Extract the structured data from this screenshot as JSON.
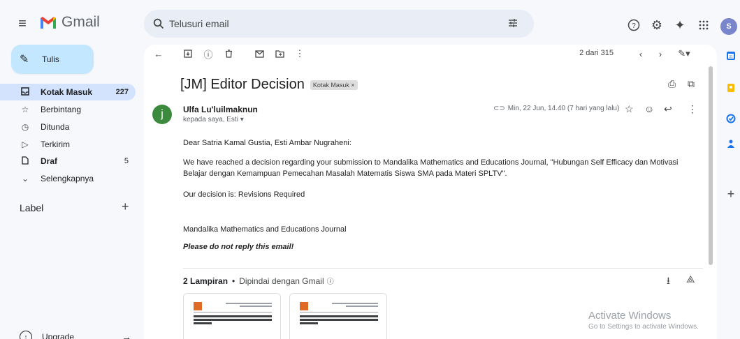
{
  "header": {
    "app_name": "Gmail",
    "search_placeholder": "Telusuri email",
    "avatar_letter": "S"
  },
  "sidebar": {
    "compose_label": "Tulis",
    "items": [
      {
        "label": "Kotak Masuk",
        "count": "227",
        "active": true,
        "icon": "inbox-icon"
      },
      {
        "label": "Berbintang",
        "count": "",
        "active": false,
        "icon": "star-icon"
      },
      {
        "label": "Ditunda",
        "count": "",
        "active": false,
        "icon": "clock-icon"
      },
      {
        "label": "Terkirim",
        "count": "",
        "active": false,
        "icon": "send-icon"
      },
      {
        "label": "Draf",
        "count": "5",
        "active": false,
        "icon": "draft-icon"
      },
      {
        "label": "Selengkapnya",
        "count": "",
        "active": false,
        "icon": "chevron-down-icon"
      }
    ],
    "label_header": "Label",
    "upgrade_label": "Upgrade"
  },
  "toolbar": {
    "pager": "2 dari 315"
  },
  "email": {
    "subject": "[JM] Editor Decision",
    "subject_chip": "Kotak Masuk ×",
    "sender_initial": "j",
    "sender_name": "Ulfa Lu'luilmaknun",
    "recipients": "kepada saya, Esti ▾",
    "date": "Min, 22 Jun, 14.40 (7 hari yang lalu)",
    "greeting": "Dear Satria Kamal Gustia, Esti Ambar Nugraheni:",
    "paragraph1": "We have reached a decision regarding your submission to Mandalika Mathematics and Educations Journal, \"Hubungan Self Efficacy dan Motivasi Belajar dengan Kemampuan Pemecahan Masalah Matematis Siswa SMA pada Materi SPLTV\".",
    "decision": "Our decision is: Revisions Required",
    "journal": "Mandalika Mathematics and Educations Journal",
    "noreply": "Please do not reply this email!",
    "attachments_count": "2 Lampiran",
    "attachments_scan": "Dipindai dengan Gmail",
    "attachments_sep": "•"
  },
  "watermark": {
    "title": "Activate Windows",
    "subtitle": "Go to Settings to activate Windows."
  },
  "colors": {
    "compose_bg": "#c2e7ff",
    "active_nav_bg": "#d3e3fd",
    "sender_avatar": "#3b8a3e"
  }
}
